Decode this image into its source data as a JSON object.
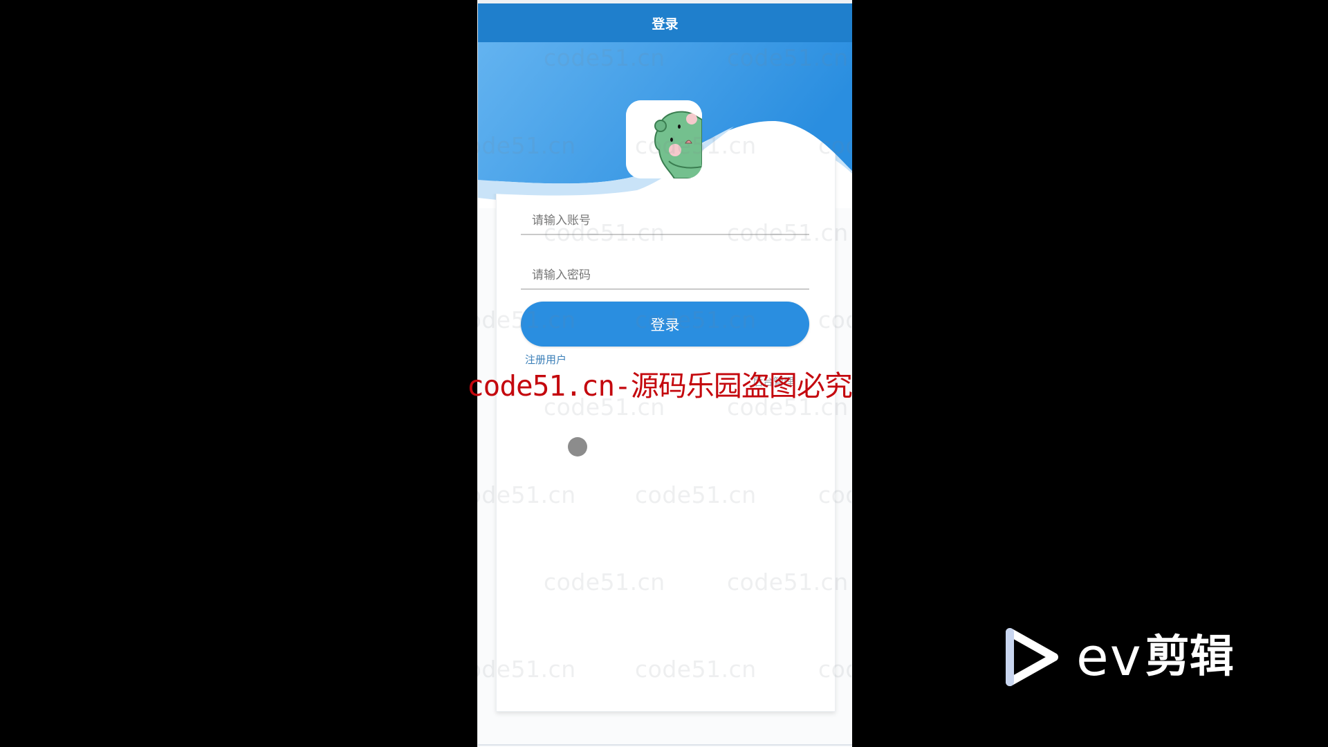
{
  "app": {
    "nav_title": "登录"
  },
  "login_form": {
    "account_placeholder": "请输入账号",
    "password_placeholder": "请输入密码",
    "submit_label": "登录",
    "register_link": "注册用户",
    "admin_link": "后台管理"
  },
  "overlays": {
    "watermark_tile_text": "code51.cn",
    "red_watermark": "code51.cn-源码乐园盗图必究",
    "editor_logo_latin": "ev",
    "editor_logo_cn": "剪辑"
  },
  "colors": {
    "nav_bar": "#1f7fcc",
    "primary_button": "#2a8ee0",
    "link": "#3b7fb8",
    "watermark_red": "#c4080e",
    "hero_gradient_start": "#63b3f0",
    "hero_gradient_end": "#2a8ee0"
  }
}
